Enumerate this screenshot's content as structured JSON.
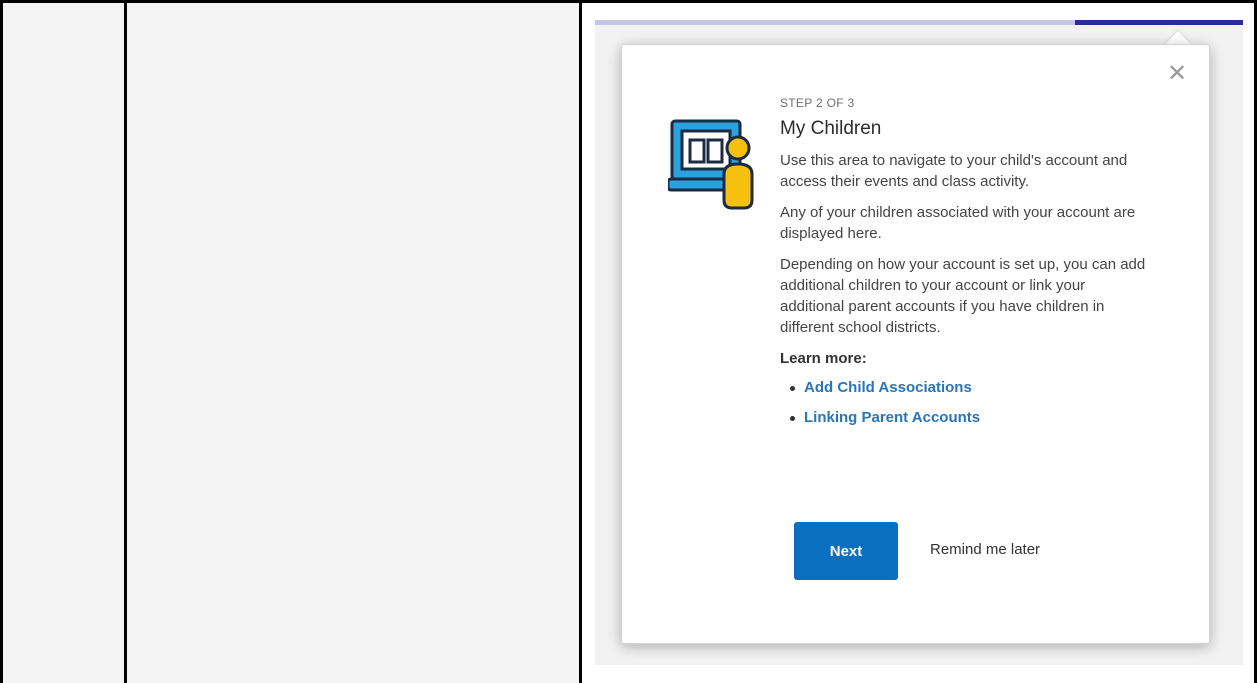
{
  "tour": {
    "step_label": "STEP 2 OF 3",
    "step_current": 2,
    "step_total": 3,
    "title": "My Children",
    "paragraphs": [
      "Use this area to navigate to your child's account and access their events and class activity.",
      "Any of your children associated with your account are displayed here.",
      "Depending on how your account is set up, you can add additional children to your account or link your additional parent accounts if you have children in different school districts."
    ],
    "learn_more_label": "Learn more:",
    "links": [
      {
        "label": "Add Child Associations"
      },
      {
        "label": "Linking Parent Accounts"
      }
    ],
    "next_label": "Next",
    "remind_label": "Remind me later",
    "close_glyph": "✕",
    "illustration_icon": "laptop-child-icon"
  },
  "colors": {
    "accent_blue": "#0b6fbf",
    "link_blue": "#2a74b8",
    "progress_fill": "#2b2f93",
    "progress_track": "#c4c6e2",
    "illustration_blue": "#2aa2dd",
    "illustration_yellow": "#f6c00e"
  }
}
